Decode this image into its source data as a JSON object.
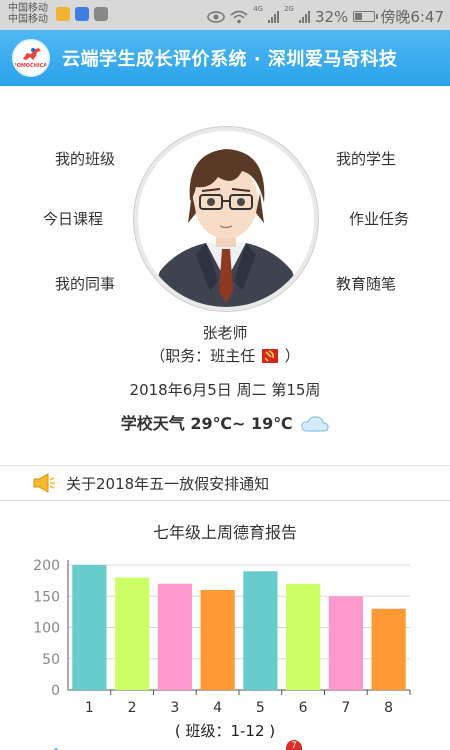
{
  "status_bar": {
    "carrier_1": "中国移动",
    "carrier_2": "中国移动",
    "net_1": "4G",
    "net_2": "2G",
    "battery": "32%",
    "time": "傍晚6:47"
  },
  "header": {
    "title": "云端学生成长评价系统 · 深圳爱马奇科技",
    "logo_text": "IOMOCHICA"
  },
  "menu": {
    "my_class": "我的班级",
    "today_courses": "今日课程",
    "my_colleagues": "我的同事",
    "my_students": "我的学生",
    "homework_tasks": "作业任务",
    "teaching_notes": "教育随笔"
  },
  "teacher": {
    "name": "张老师",
    "role_prefix": "（职务：班主任",
    "role_suffix": "）"
  },
  "date_line": "2018年6月5日 周二 第15周",
  "weather": {
    "label": "学校天气",
    "temp": "29℃~ 19℃"
  },
  "notice": {
    "text": "关于2018年五一放假安排通知"
  },
  "chart_data": {
    "type": "bar",
    "title": "七年级上周德育报告",
    "categories": [
      "1",
      "2",
      "3",
      "4",
      "5",
      "6",
      "7",
      "8"
    ],
    "values": [
      200,
      180,
      170,
      160,
      190,
      170,
      150,
      130
    ],
    "ylim": [
      0,
      200
    ],
    "yticks": [
      0,
      50,
      100,
      150,
      200
    ],
    "colors": [
      "#66cccc",
      "#ccff66",
      "#ff99cc",
      "#ff9933",
      "#66cccc",
      "#ccff66",
      "#ff99cc",
      "#ff9933"
    ],
    "xlabel": "( 班级：1-12 )",
    "grid": true
  },
  "bottom_nav": {
    "badge_count": "7"
  }
}
